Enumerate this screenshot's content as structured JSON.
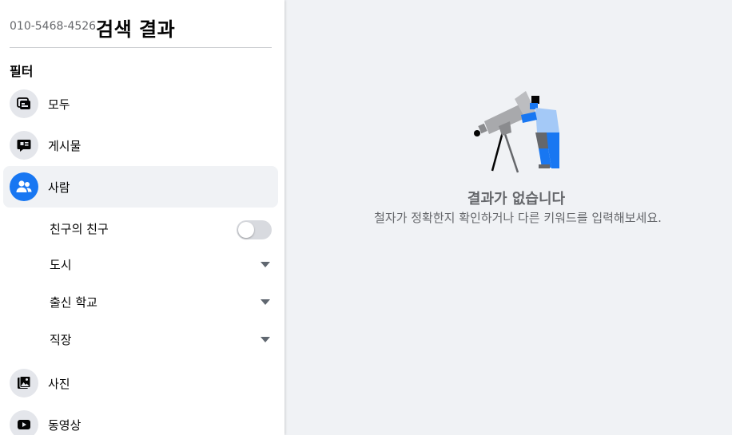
{
  "header": {
    "query": "010-5468-4526",
    "title": "검색 결과"
  },
  "filters": {
    "heading": "필터",
    "items": [
      {
        "label": "모두"
      },
      {
        "label": "게시물"
      },
      {
        "label": "사람"
      },
      {
        "label": "사진"
      },
      {
        "label": "동영상"
      }
    ],
    "people_sub": {
      "friends_of_friends": "친구의 친구",
      "friends_of_friends_enabled": false,
      "city": "도시",
      "school": "출신 학교",
      "work": "직장"
    }
  },
  "empty_state": {
    "title": "결과가 없습니다",
    "subtitle": "철자가 정확한지 확인하거나 다른 키워드를 입력해보세요."
  },
  "colors": {
    "accent": "#1877f2",
    "secondary_text": "#65676b",
    "background": "#f0f2f5"
  }
}
